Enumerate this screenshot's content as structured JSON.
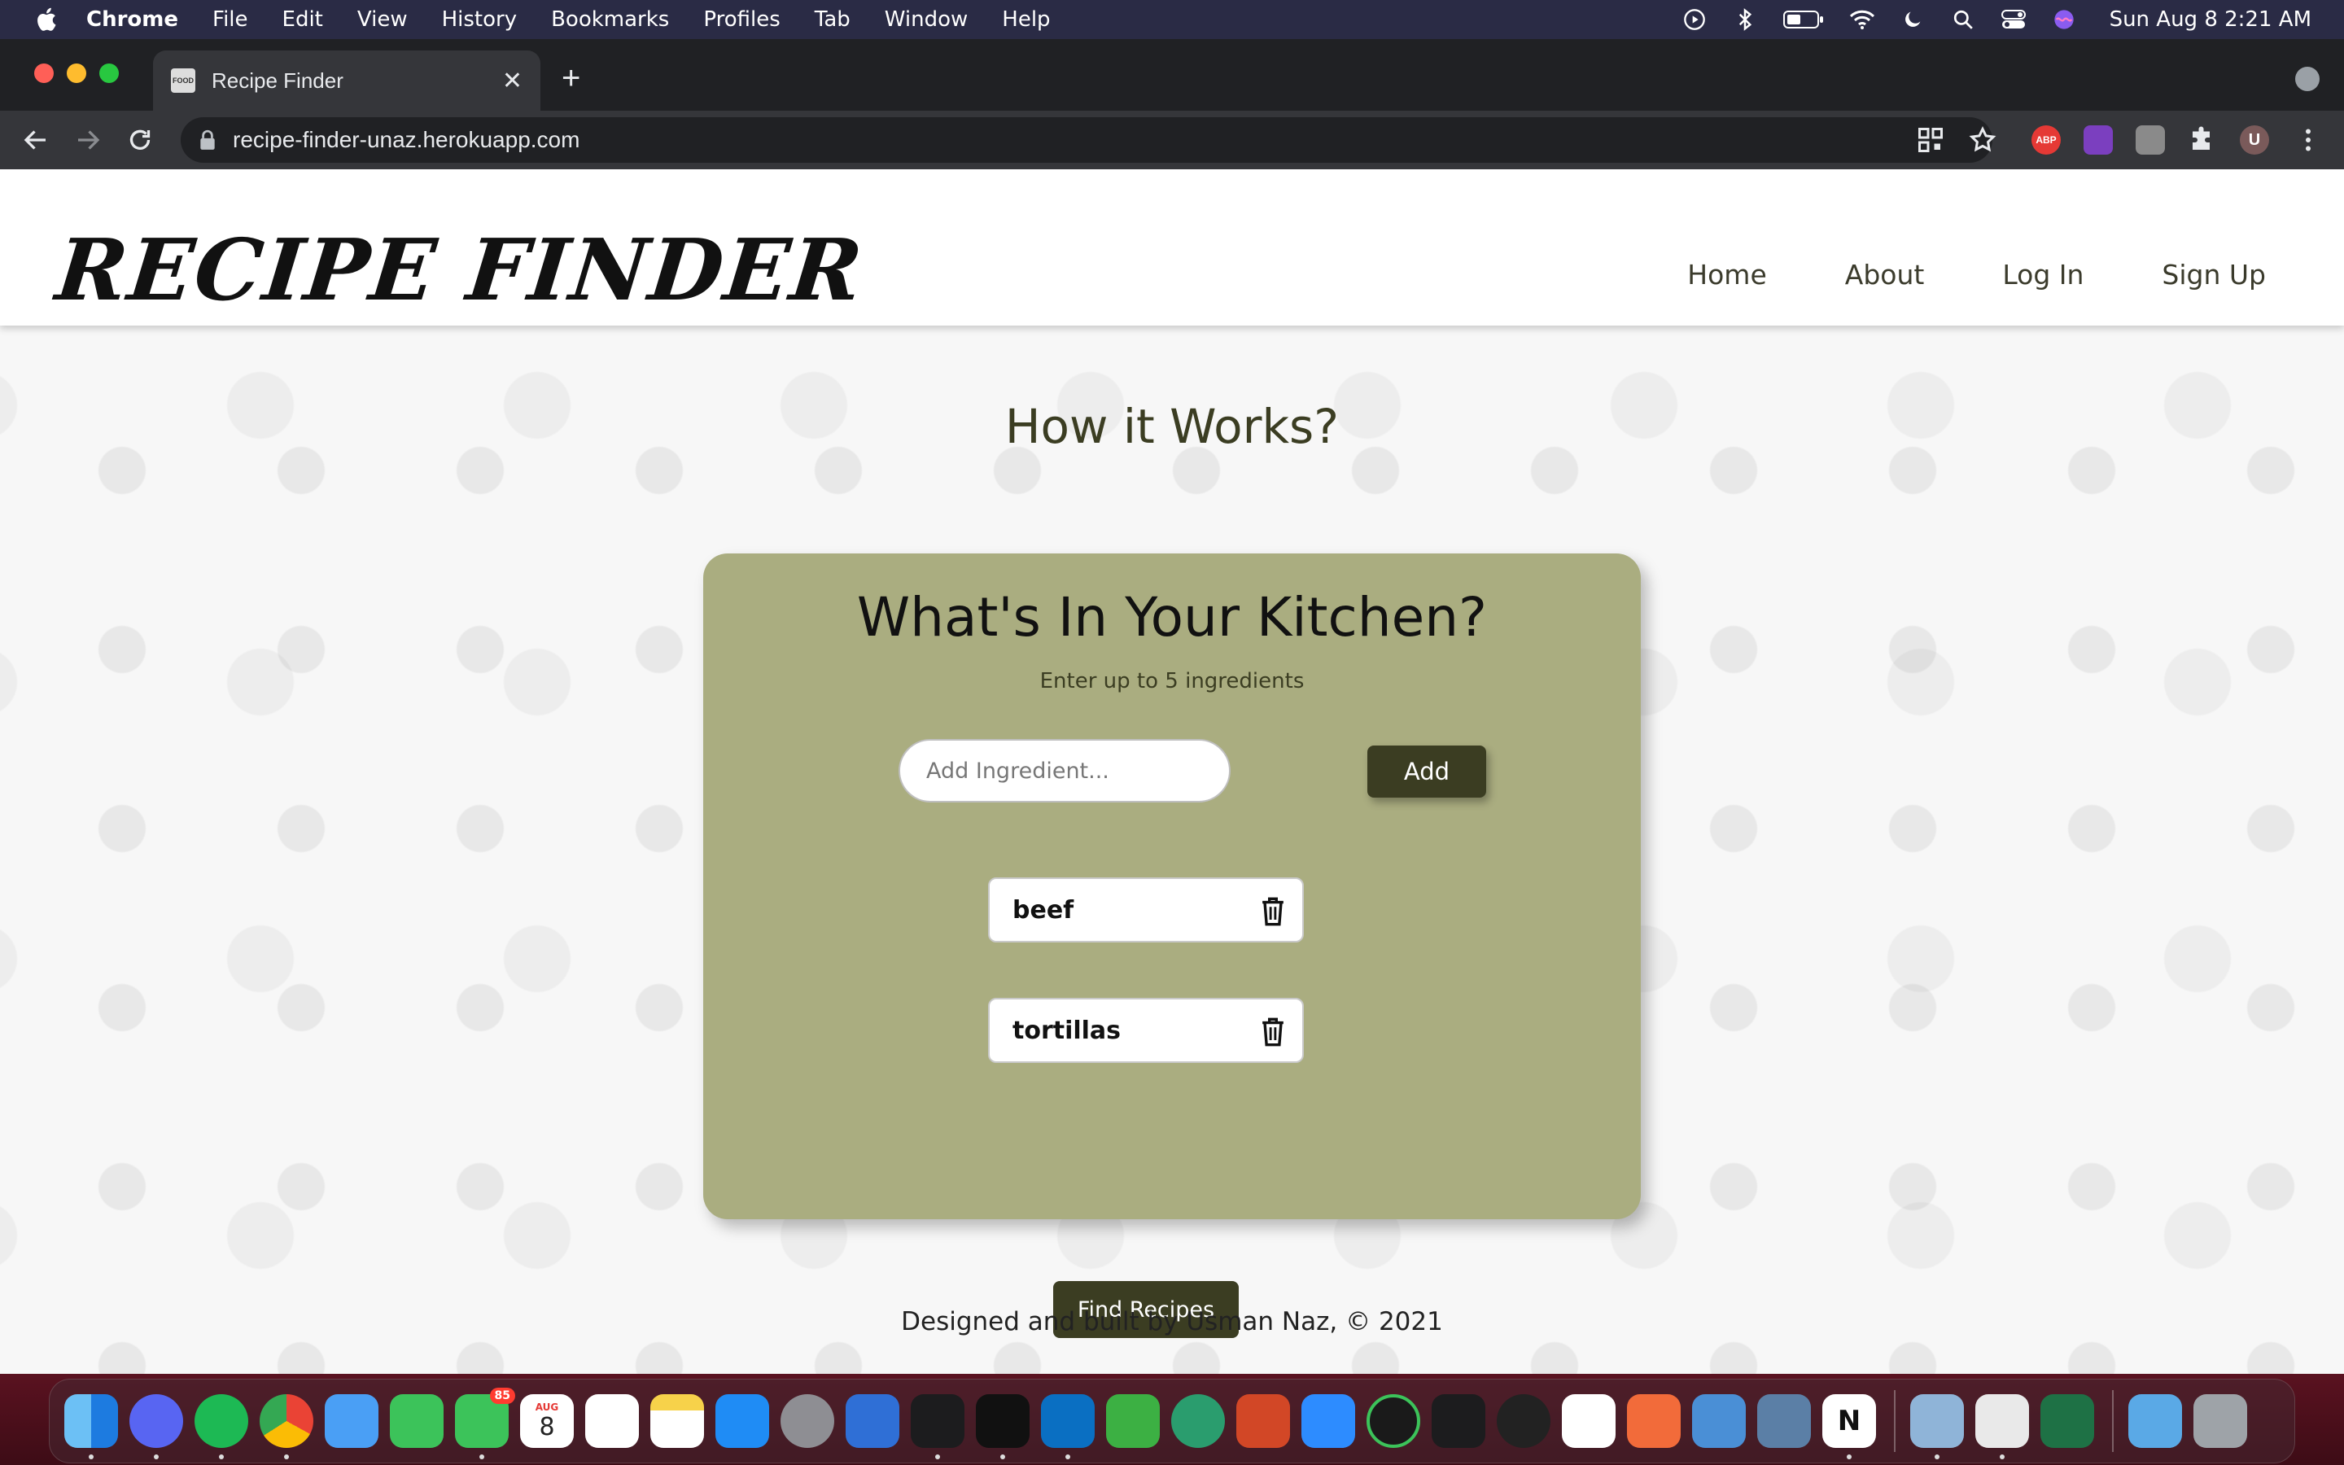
{
  "menubar": {
    "app": "Chrome",
    "items": [
      "File",
      "Edit",
      "View",
      "History",
      "Bookmarks",
      "Profiles",
      "Tab",
      "Window",
      "Help"
    ],
    "clock": "Sun Aug 8  2:21 AM"
  },
  "browser": {
    "tab_title": "Recipe Finder",
    "tab_favicon_text": "FOOD",
    "url": "recipe-finder-unaz.herokuapp.com",
    "extensions": [
      {
        "name": "adblock-plus-extension",
        "label": "ABP",
        "color": "#e53935"
      },
      {
        "name": "purple-extension",
        "label": "",
        "color": "#7b3fbf"
      },
      {
        "name": "gray-extension",
        "label": "",
        "color": "#8a8a8a"
      }
    ],
    "profile_initial": "U"
  },
  "site": {
    "logo": "Recipe Finder",
    "nav": [
      "Home",
      "About",
      "Log In",
      "Sign Up"
    ],
    "how_title": "How it Works?",
    "card": {
      "title": "What's In Your Kitchen?",
      "subtitle": "Enter up to 5 ingredients",
      "input_placeholder": "Add Ingredient...",
      "add_label": "Add",
      "ingredients": [
        "beef",
        "tortillas"
      ],
      "find_label": "Find Recipes"
    },
    "footer": "Designed and built by Usman Naz, © 2021"
  },
  "dock": {
    "calendar_month": "AUG",
    "calendar_day": "8",
    "messages_badge": "85"
  },
  "colors": {
    "card_bg": "#aaad80",
    "button_bg": "#3b3d22",
    "menubar_bg": "#2a2b45"
  }
}
